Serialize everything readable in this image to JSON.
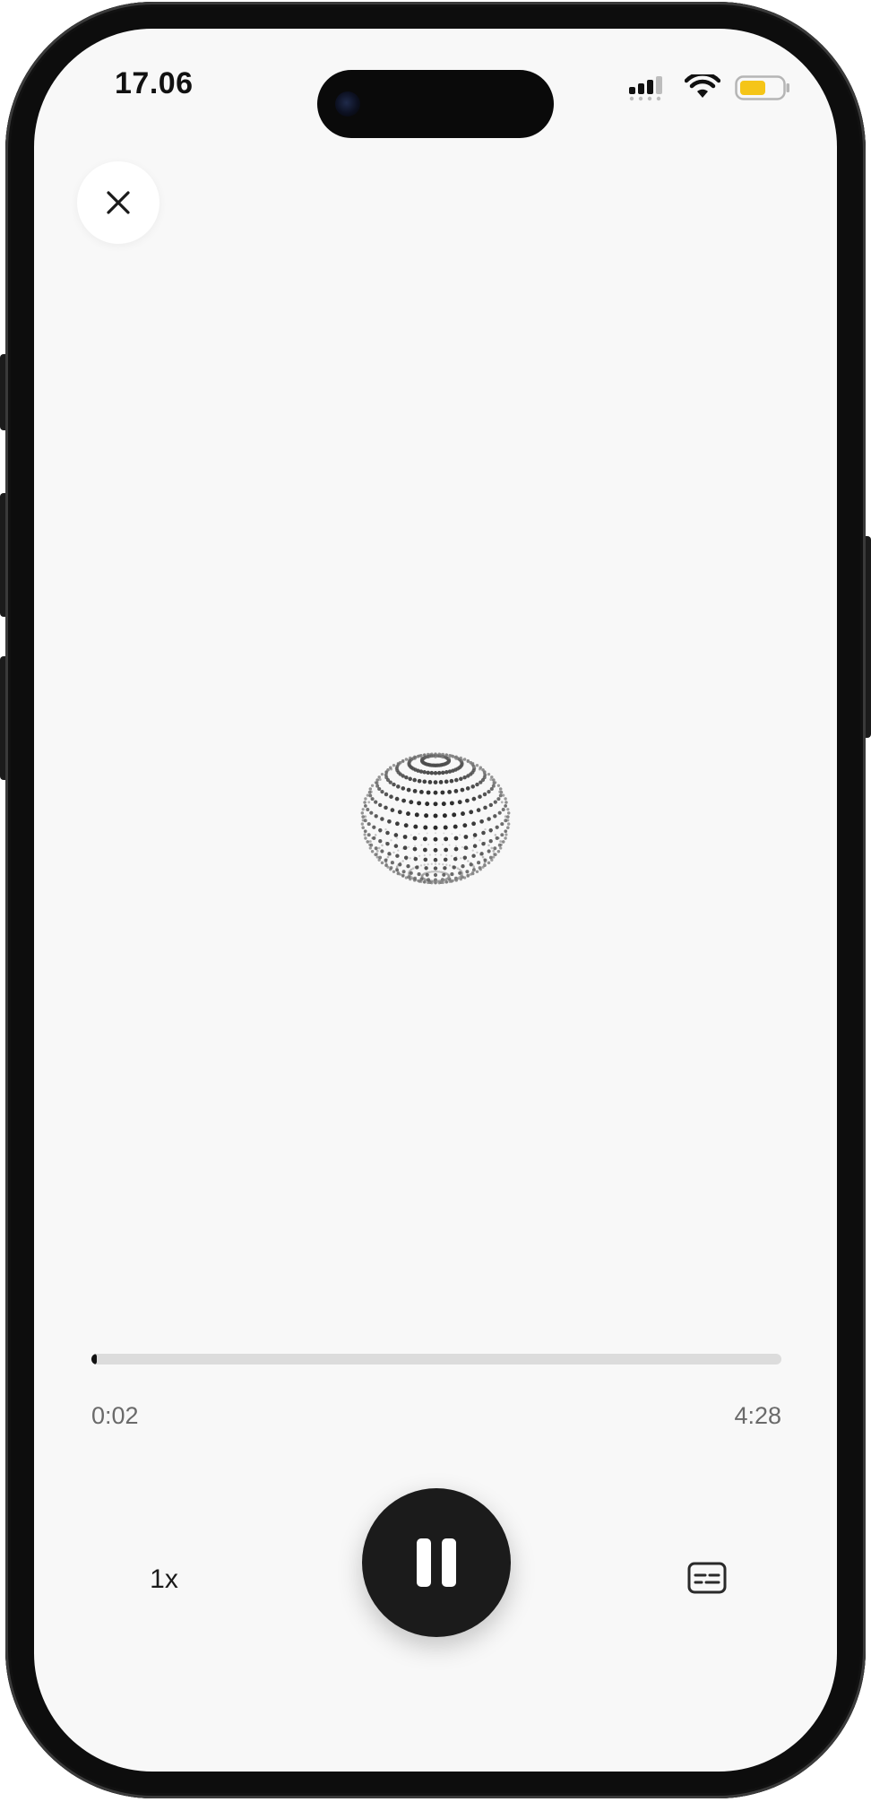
{
  "status_bar": {
    "time": "17.06",
    "signal_icon": "cellular-signal-icon",
    "wifi_icon": "wifi-icon",
    "battery_icon": "battery-icon",
    "battery_color": "#f5c518"
  },
  "header": {
    "close_icon": "close-icon"
  },
  "visualizer": {
    "icon": "dotted-sphere-icon"
  },
  "player": {
    "progress": 0.008,
    "elapsed": "0:02",
    "total": "4:28",
    "speed_label": "1x",
    "pause_icon": "pause-icon",
    "captions_icon": "captions-icon"
  },
  "colors": {
    "background": "#f8f8f8",
    "play_button": "#1b1b1b",
    "track": "#dcdcdc"
  }
}
